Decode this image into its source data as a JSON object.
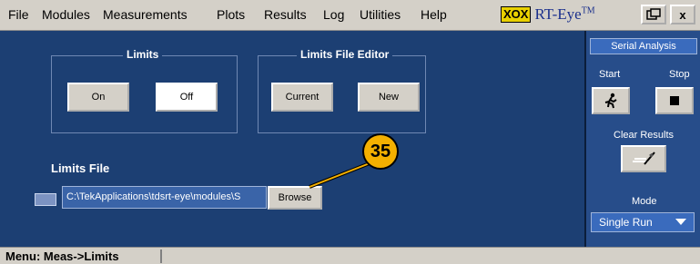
{
  "menubar": {
    "items": [
      "File",
      "Modules",
      "Measurements",
      "Plots",
      "Results",
      "Log",
      "Utilities",
      "Help"
    ],
    "logo_box": "XOX",
    "logo_text": "RT-Eye",
    "logo_tm": "TM",
    "close_label": "x"
  },
  "limits_group": {
    "title": "Limits",
    "on_label": "On",
    "off_label": "Off"
  },
  "editor_group": {
    "title": "Limits File Editor",
    "current_label": "Current",
    "new_label": "New"
  },
  "limits_file": {
    "label": "Limits File",
    "path_value": "C:\\TekApplications\\tdsrt-eye\\modules\\S",
    "browse_label": "Browse"
  },
  "callout": {
    "number": "35"
  },
  "right_panel": {
    "header": "Serial Analysis",
    "start_label": "Start",
    "stop_label": "Stop",
    "clear_label": "Clear Results",
    "mode_label": "Mode",
    "mode_value": "Single Run"
  },
  "statusbar": {
    "text": "Menu: Meas->Limits"
  }
}
